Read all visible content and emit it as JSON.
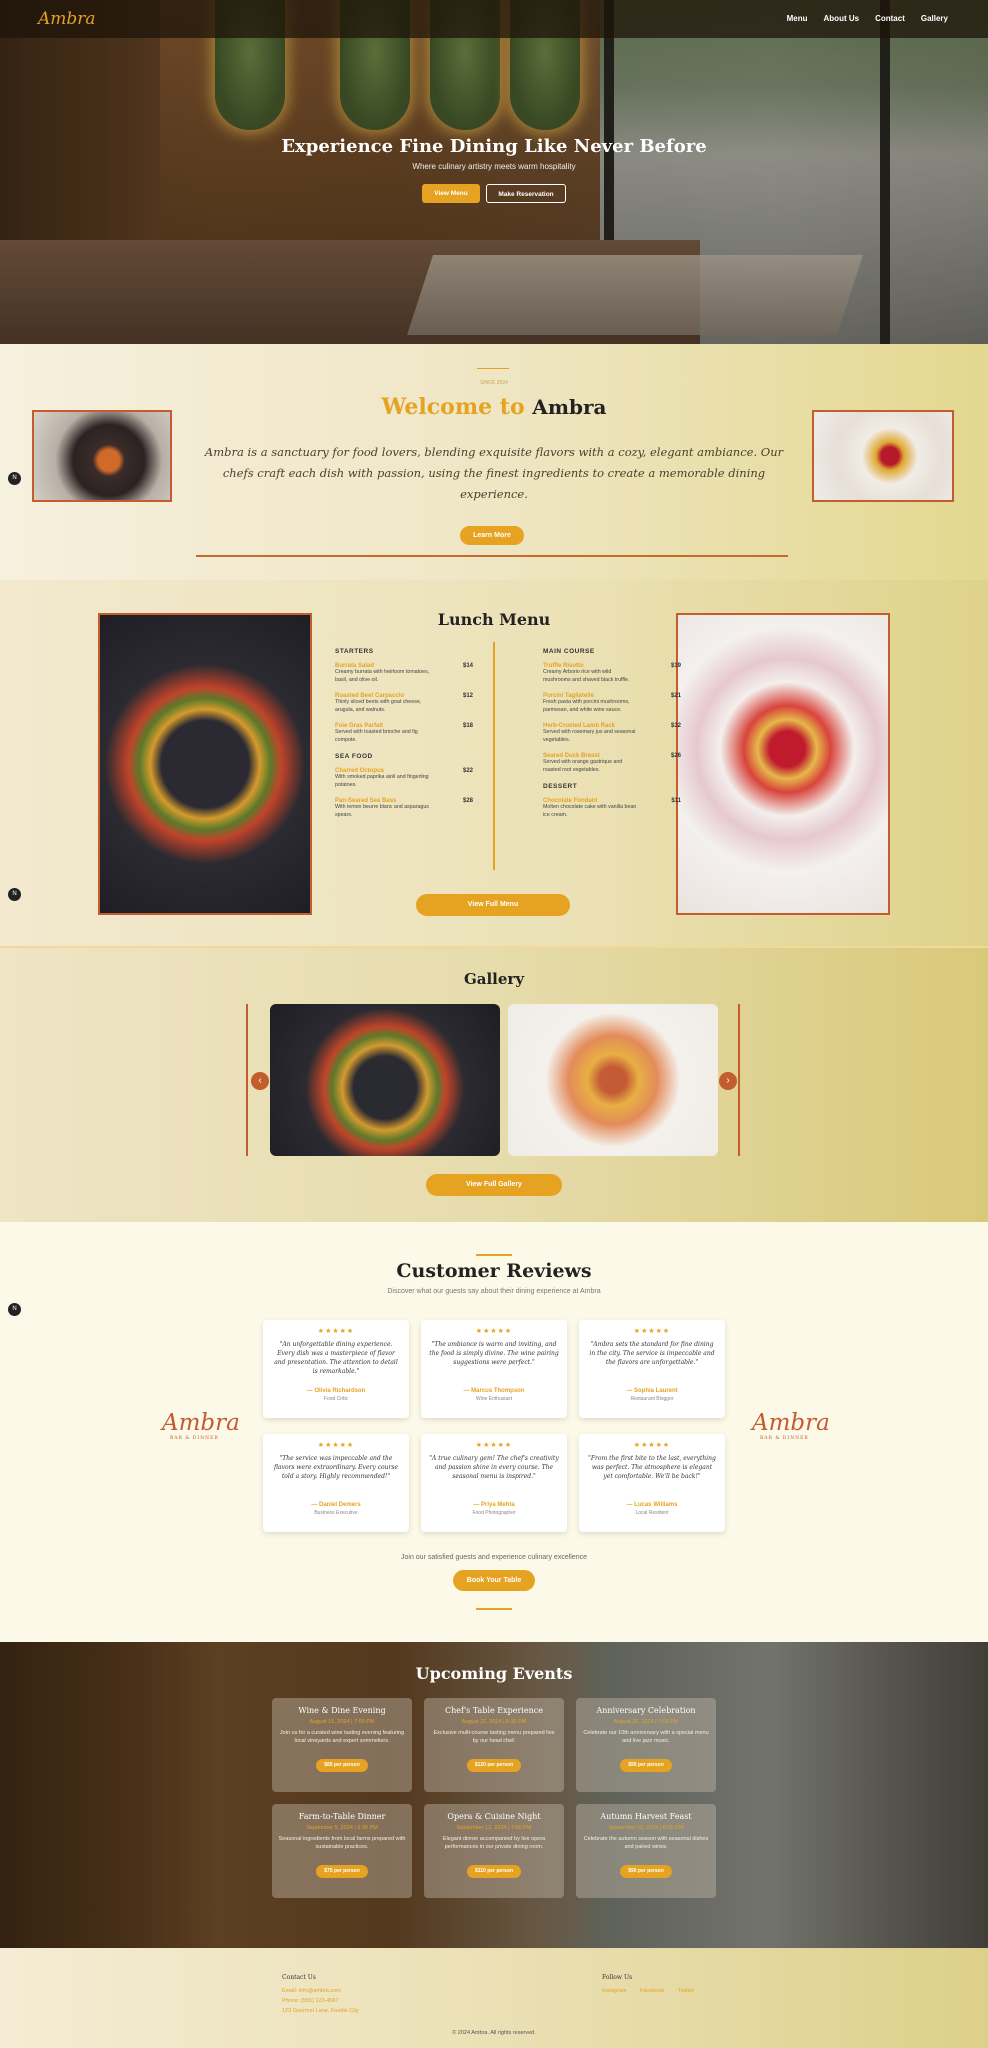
{
  "brand": {
    "logo": "Ambra",
    "tagline": "BAR & DINNER"
  },
  "nav": [
    "Menu",
    "About Us",
    "Contact",
    "Gallery"
  ],
  "hero": {
    "title": "Experience Fine Dining Like Never Before",
    "subtitle": "Where culinary artistry meets warm hospitality",
    "btn_menu": "View Menu",
    "btn_reserve": "Make Reservation"
  },
  "welcome": {
    "overline": "SINCE 2024",
    "title_prefix": "Welcome to",
    "title_brand": "Ambra",
    "brand_tag": "BAR & DINNER",
    "text": "Ambra is a sanctuary for food lovers, blending exquisite flavors with a cozy, elegant ambiance. Our chefs craft each dish with passion, using the finest ingredients to create a memorable dining experience.",
    "button": "Learn More"
  },
  "lunch": {
    "title": "Lunch Menu",
    "col1": [
      {
        "section": "STARTERS",
        "items": [
          {
            "name": "Burrata Salad",
            "desc": "Creamy burrata with heirloom tomatoes, basil, and olive oil.",
            "price": "$14"
          },
          {
            "name": "Roasted Beet Carpaccio",
            "desc": "Thinly sliced beets with goat cheese, arugula, and walnuts.",
            "price": "$12"
          },
          {
            "name": "Foie Gras Parfait",
            "desc": "Served with toasted brioche and fig compote.",
            "price": "$18"
          }
        ]
      },
      {
        "section": "SEA FOOD",
        "items": [
          {
            "name": "Charred Octopus",
            "desc": "With smoked paprika aioli and fingerling potatoes.",
            "price": "$22"
          },
          {
            "name": "Pan-Seared Sea Bass",
            "desc": "With lemon beurre blanc and asparagus spears.",
            "price": "$28"
          }
        ]
      }
    ],
    "col2": [
      {
        "section": "MAIN COURSE",
        "items": [
          {
            "name": "Truffle Risotto",
            "desc": "Creamy Arborio rice with wild mushrooms and shaved black truffle.",
            "price": "$19"
          },
          {
            "name": "Porcini Tagliatelle",
            "desc": "Fresh pasta with porcini mushrooms, parmesan, and white wine sauce.",
            "price": "$21"
          },
          {
            "name": "Herb-Crusted Lamb Rack",
            "desc": "Served with rosemary jus and seasonal vegetables.",
            "price": "$32"
          },
          {
            "name": "Seared Duck Breast",
            "desc": "Served with orange gastrique and roasted root vegetables.",
            "price": "$26"
          }
        ]
      },
      {
        "section": "DESSERT",
        "items": [
          {
            "name": "Chocolate Fondant",
            "desc": "Molten chocolate cake with vanilla bean ice cream.",
            "price": "$11"
          }
        ]
      }
    ],
    "button": "View Full Menu"
  },
  "gallery": {
    "title": "Gallery",
    "button": "View Full Gallery",
    "prev": "‹",
    "next": "›"
  },
  "reviews": {
    "title": "Customer Reviews",
    "subtitle": "Discover what our guests say about their dining experience at Ambra",
    "items": [
      {
        "stars": "★★★★★",
        "quote": "\"An unforgettable dining experience. Every dish was a masterpiece of flavor and presentation. The attention to detail is remarkable.\"",
        "name": "— Olivia Richardson",
        "role": "Food Critic"
      },
      {
        "stars": "★★★★★",
        "quote": "\"The ambiance is warm and inviting, and the food is simply divine. The wine pairing suggestions were perfect.\"",
        "name": "— Marcus Thompson",
        "role": "Wine Enthusiast"
      },
      {
        "stars": "★★★★★",
        "quote": "\"Ambra sets the standard for fine dining in the city. The service is impeccable and the flavors are unforgettable.\"",
        "name": "— Sophia Laurent",
        "role": "Restaurant Blogger"
      },
      {
        "stars": "★★★★★",
        "quote": "\"The service was impeccable and the flavors were extraordinary. Every course told a story. Highly recommended!\"",
        "name": "— Daniel Demers",
        "role": "Business Executive"
      },
      {
        "stars": "★★★★★",
        "quote": "\"A true culinary gem! The chef's creativity and passion shine in every course. The seasonal menu is inspired.\"",
        "name": "— Priya Mehta",
        "role": "Food Photographer"
      },
      {
        "stars": "★★★★★",
        "quote": "\"From the first bite to the last, everything was perfect. The atmosphere is elegant yet comfortable. We'll be back!\"",
        "name": "— Lucas Williams",
        "role": "Local Resident"
      }
    ],
    "join": "Join our satisfied guests and experience culinary excellence",
    "button": "Book Your Table"
  },
  "events": {
    "title": "Upcoming Events",
    "items": [
      {
        "name": "Wine & Dine Evening",
        "date": "August 15, 2024 | 7:00 PM",
        "desc": "Join us for a curated wine tasting evening featuring local vineyards and expert sommeliers.",
        "price": "$85 per person"
      },
      {
        "name": "Chef's Table Experience",
        "date": "August 22, 2024 | 6:30 PM",
        "desc": "Exclusive multi-course tasting menu prepared live by our head chef.",
        "price": "$120 per person"
      },
      {
        "name": "Anniversary Celebration",
        "date": "August 30, 2024 | 7:00 PM",
        "desc": "Celebrate our 10th anniversary with a special menu and live jazz music.",
        "price": "$95 per person"
      },
      {
        "name": "Farm-to-Table Dinner",
        "date": "September 5, 2024 | 6:30 PM",
        "desc": "Seasonal ingredients from local farms prepared with sustainable practices.",
        "price": "$75 per person"
      },
      {
        "name": "Opera & Cuisine Night",
        "date": "September 12, 2024 | 7:00 PM",
        "desc": "Elegant dinner accompanied by live opera performances in our private dining room.",
        "price": "$110 per person"
      },
      {
        "name": "Autumn Harvest Feast",
        "date": "September 20, 2024 | 6:00 PM",
        "desc": "Celebrate the autumn season with seasonal dishes and paired wines.",
        "price": "$90 per person"
      }
    ]
  },
  "footer": {
    "contact_title": "Contact Us",
    "contact_lines": [
      "Email: info@ambra.com",
      "Phone: (555) 123-4567",
      "123 Gourmet Lane, Foodie City"
    ],
    "follow_title": "Follow Us",
    "social": [
      "Instagram",
      "Facebook",
      "Twitter"
    ],
    "copyright": "© 2024 Ambra. All rights reserved."
  },
  "side_markers": [
    "N",
    "N",
    "N"
  ],
  "colors": {
    "accent": "#e5a321",
    "rust": "#c25d2e"
  }
}
